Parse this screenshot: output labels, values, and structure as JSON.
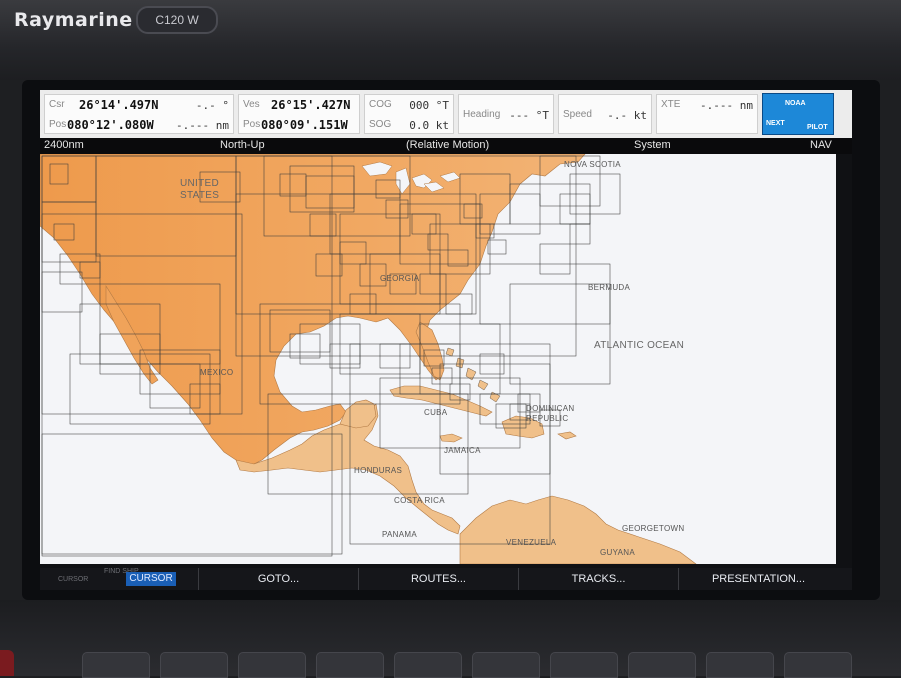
{
  "device": {
    "brand": "Raymarine",
    "model": "C120 W"
  },
  "databar": {
    "csr_label": "Csr",
    "csr_lat": "26°14'.497N",
    "csr_brg": "-.- °",
    "pos_label": "Pos",
    "csr_lon": "080°12'.080W",
    "csr_rng": "-.--- nm",
    "ves_label": "Ves",
    "ves_lat": "26°15'.427N",
    "ves_pos_label": "Pos",
    "ves_lon": "080°09'.151W",
    "cog_label": "COG",
    "cog_value": "000 °T",
    "sog_label": "SOG",
    "sog_value": "0.0 kt",
    "heading_label": "Heading",
    "heading_value": "--- °T",
    "speed_label": "Speed",
    "speed_value": "-.- kt",
    "xte_label": "XTE",
    "xte_value": "-.--- nm",
    "logo_top": "NOAA",
    "logo_left": "NEXT",
    "logo_right": "PILOT"
  },
  "status_bar": {
    "range": "2400nm",
    "orientation": "North-Up",
    "motion": "(Relative Motion)",
    "mode": "System",
    "nav": "NAV"
  },
  "map_labels": {
    "united_states": "UNITED\nSTATES",
    "nova_scotia": "NOVA SCOTIA",
    "georgia": "GEORGIA",
    "bermuda": "BERMUDA",
    "atlantic": "ATLANTIC OCEAN",
    "mexico": "MEXICO",
    "cuba": "CUBA",
    "dominican": "DOMINICAN\nREPUBLIC",
    "jamaica": "JAMAICA",
    "honduras": "HONDURAS",
    "costa_rica": "COSTA RICA",
    "panama": "PANAMA",
    "venezuela": "VENEZUELA",
    "georgetown": "GEORGETOWN",
    "guyana": "GUYANA"
  },
  "softkeys": {
    "small_left": "CURSOR",
    "small_top": "FIND SHIP",
    "cursor": "CURSOR",
    "goto": "GOTO...",
    "routes": "ROUTES...",
    "tracks": "TRACKS...",
    "presentation": "PRESENTATION..."
  },
  "colors": {
    "land_orange": "#efa157",
    "land_light": "#f0c28c",
    "sea": "#f4f5f8",
    "softkey_active": "#1a5fb6",
    "logo_blue": "#1d88d8"
  }
}
